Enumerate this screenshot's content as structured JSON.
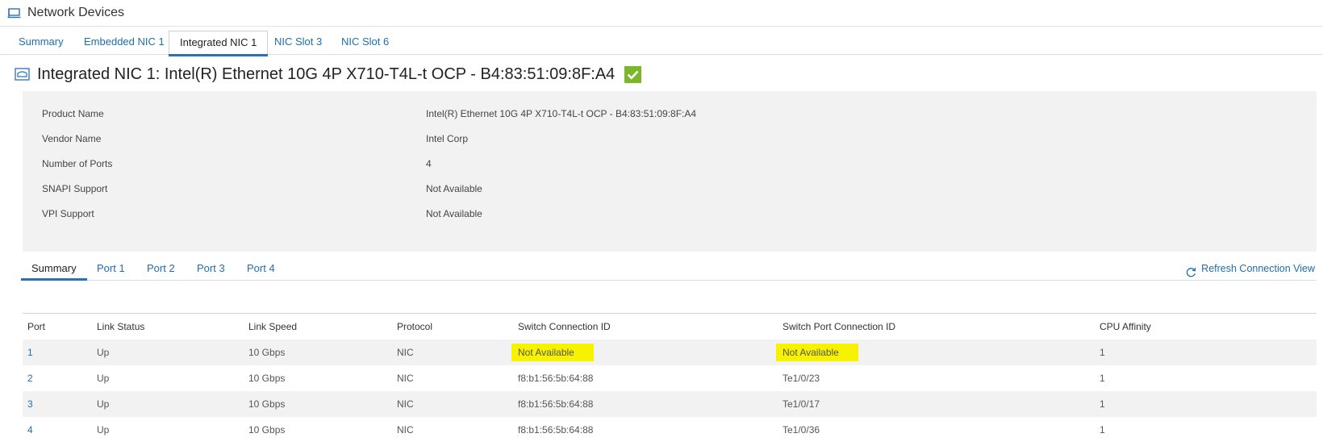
{
  "header": {
    "title": "Network Devices",
    "icon": "network-devices-icon"
  },
  "tabs": [
    {
      "label": "Summary",
      "active": false
    },
    {
      "label": "Embedded NIC 1",
      "active": false
    },
    {
      "label": "Integrated NIC 1",
      "active": true
    },
    {
      "label": "NIC Slot 3",
      "active": false
    },
    {
      "label": "NIC Slot 6",
      "active": false
    }
  ],
  "section": {
    "title": "Integrated NIC 1: Intel(R) Ethernet 10G 4P X710-T4L-t OCP - B4:83:51:09:8F:A4",
    "status_icon": "check-ok-icon",
    "status_color": "#7ab829"
  },
  "details": [
    {
      "label": "Product Name",
      "value": "Intel(R) Ethernet 10G 4P X710-T4L-t OCP - B4:83:51:09:8F:A4"
    },
    {
      "label": "Vendor Name",
      "value": "Intel Corp"
    },
    {
      "label": "Number of Ports",
      "value": "4"
    },
    {
      "label": "SNAPI Support",
      "value": "Not Available"
    },
    {
      "label": "VPI Support",
      "value": "Not Available"
    }
  ],
  "subtabs": [
    {
      "label": "Summary",
      "active": true
    },
    {
      "label": "Port 1",
      "active": false
    },
    {
      "label": "Port 2",
      "active": false
    },
    {
      "label": "Port 3",
      "active": false
    },
    {
      "label": "Port 4",
      "active": false
    }
  ],
  "refresh_label": "Refresh Connection View",
  "table": {
    "columns": [
      "Port",
      "Link Status",
      "Link Speed",
      "Protocol",
      "Switch Connection ID",
      "Switch Port Connection ID",
      "CPU Affinity"
    ],
    "rows": [
      {
        "port": "1",
        "link_status": "Up",
        "link_speed": "10 Gbps",
        "protocol": "NIC",
        "switch_conn_id": "Not Available",
        "switch_port_conn_id": "Not Available",
        "cpu_affinity": "1"
      },
      {
        "port": "2",
        "link_status": "Up",
        "link_speed": "10 Gbps",
        "protocol": "NIC",
        "switch_conn_id": "f8:b1:56:5b:64:88",
        "switch_port_conn_id": "Te1/0/23",
        "cpu_affinity": "1"
      },
      {
        "port": "3",
        "link_status": "Up",
        "link_speed": "10 Gbps",
        "protocol": "NIC",
        "switch_conn_id": "f8:b1:56:5b:64:88",
        "switch_port_conn_id": "Te1/0/17",
        "cpu_affinity": "1"
      },
      {
        "port": "4",
        "link_status": "Up",
        "link_speed": "10 Gbps",
        "protocol": "NIC",
        "switch_conn_id": "f8:b1:56:5b:64:88",
        "switch_port_conn_id": "Te1/0/36",
        "cpu_affinity": "1"
      }
    ]
  },
  "colors": {
    "accent": "#2b71b8",
    "link": "#1f6ead",
    "highlight": "#f6f200",
    "panel": "#f2f2f2"
  }
}
